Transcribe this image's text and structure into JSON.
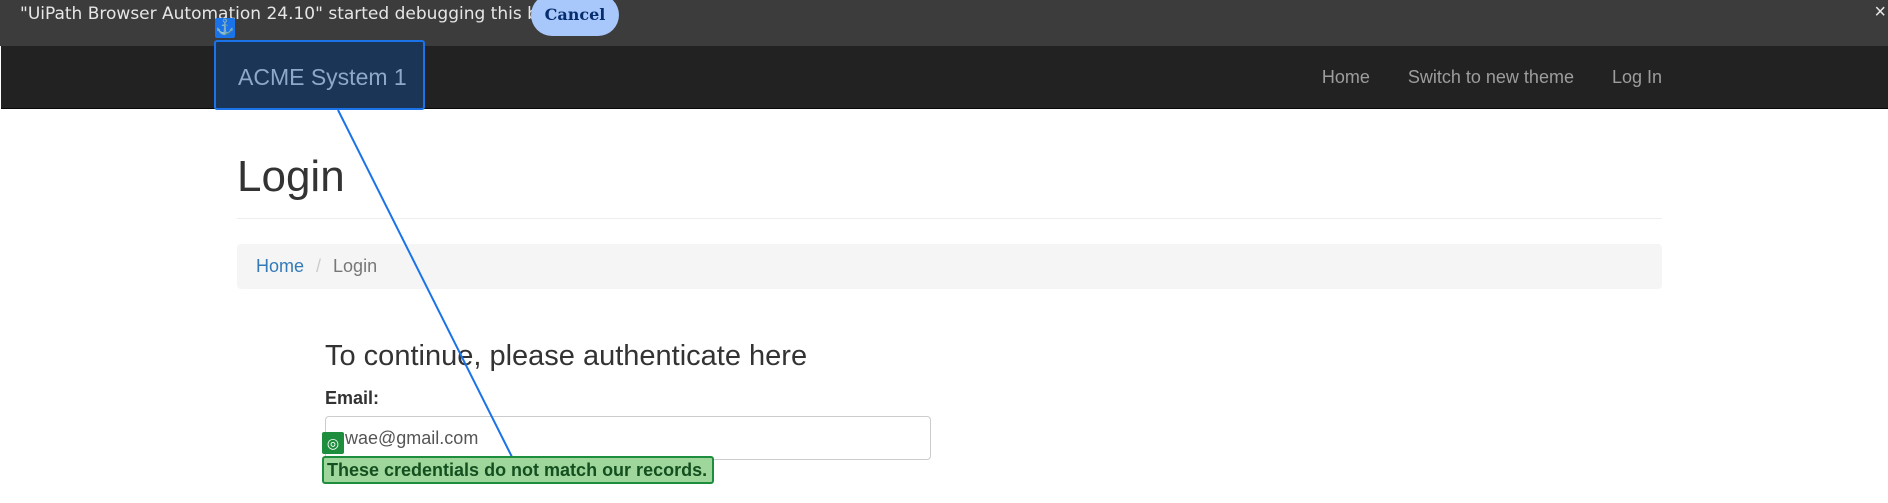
{
  "debug_banner": {
    "message": "\"UiPath Browser Automation 24.10\" started debugging this browser",
    "cancel_label": "Cancel",
    "close_icon": "×"
  },
  "navbar": {
    "brand": "ACME System 1",
    "links": [
      "Home",
      "Switch to new theme",
      "Log In"
    ]
  },
  "page": {
    "title": "Login",
    "breadcrumb": {
      "home": "Home",
      "separator": "/",
      "current": "Login"
    },
    "auth_heading": "To continue, please authenticate here",
    "email_label": "Email:",
    "email_value": "wae@gmail.com",
    "error_message": "These credentials do not match our records."
  },
  "overlay": {
    "anchor_icon": "⚓",
    "target_icon": "◎",
    "anchor_color": "#1a73e8",
    "target_color": "#1e8e3e"
  }
}
